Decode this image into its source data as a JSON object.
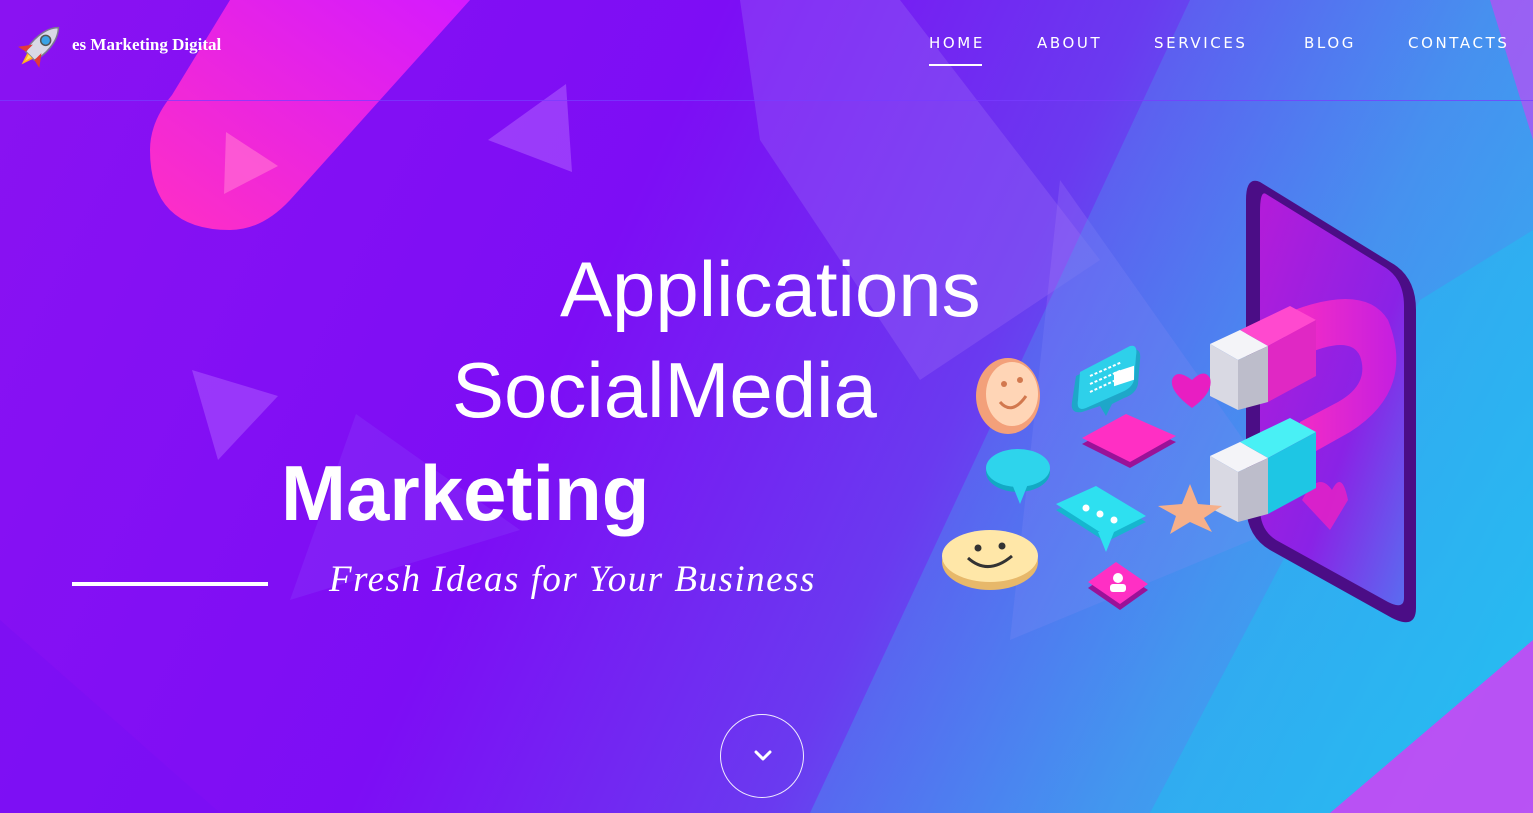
{
  "brand": {
    "logo_icon": "rocket-icon",
    "name": "es Marketing Digital"
  },
  "nav": {
    "items": [
      {
        "label": "HOME",
        "active": true
      },
      {
        "label": "ABOUT",
        "active": false
      },
      {
        "label": "SERVICES",
        "active": false
      },
      {
        "label": "BLOG",
        "active": false
      },
      {
        "label": "CONTACTS",
        "active": false
      }
    ]
  },
  "hero": {
    "line1": "Applications",
    "line2": "SocialMedia",
    "line3": "Marketing",
    "tagline": "Fresh Ideas for Your Business",
    "scroll_icon": "chevron-down-icon"
  },
  "colors": {
    "background_start": "#8a12f2",
    "background_end": "#2bb6f3",
    "accent_pink": "#ff2fc4",
    "accent_cyan": "#27d6ec",
    "text": "#ffffff"
  }
}
